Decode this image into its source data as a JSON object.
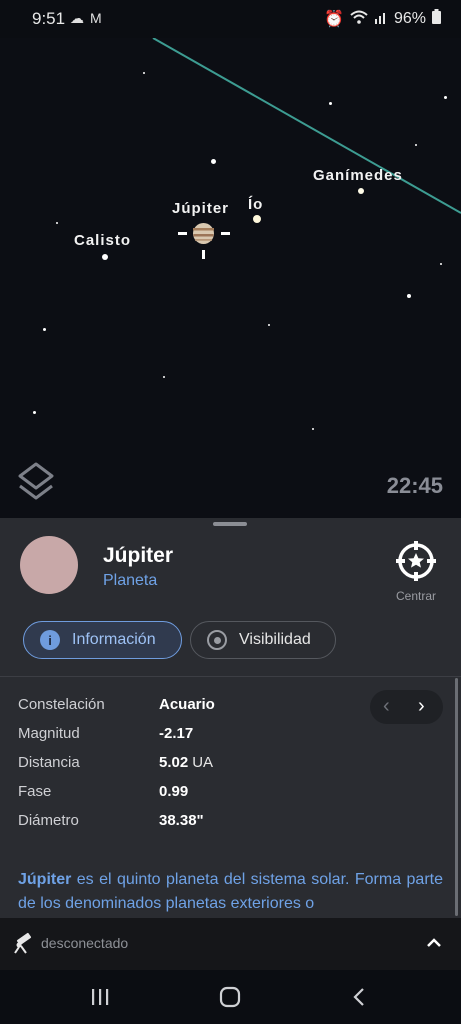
{
  "status_bar": {
    "time": "9:51",
    "battery": "96%"
  },
  "sky": {
    "labels": {
      "jupiter": "Júpiter",
      "io": "Ío",
      "ganymede": "Ganímedes",
      "callisto": "Calisto"
    },
    "time": "22:45"
  },
  "object": {
    "name": "Júpiter",
    "type": "Planeta",
    "center_label": "Centrar"
  },
  "tabs": {
    "info": "Información",
    "visibility": "Visibilidad"
  },
  "properties": [
    {
      "label": "Constelación",
      "value": "Acuario",
      "unit": ""
    },
    {
      "label": "Magnitud",
      "value": "-2.17",
      "unit": ""
    },
    {
      "label": "Distancia",
      "value": "5.02",
      "unit": "UA"
    },
    {
      "label": "Fase",
      "value": "0.99",
      "unit": ""
    },
    {
      "label": "Diámetro",
      "value": "38.38\"",
      "unit": ""
    }
  ],
  "description": {
    "highlight": "Júpiter",
    "text": " es el quinto planeta del sistema solar. Forma parte de los denominados planetas exteriores o"
  },
  "footer": {
    "status": "desconectado"
  },
  "colors": {
    "accent": "#6fa2e6",
    "sheet_bg": "#2a2c31",
    "sky_bg": "#0c0e14",
    "avatar": "#c8a8a8"
  }
}
